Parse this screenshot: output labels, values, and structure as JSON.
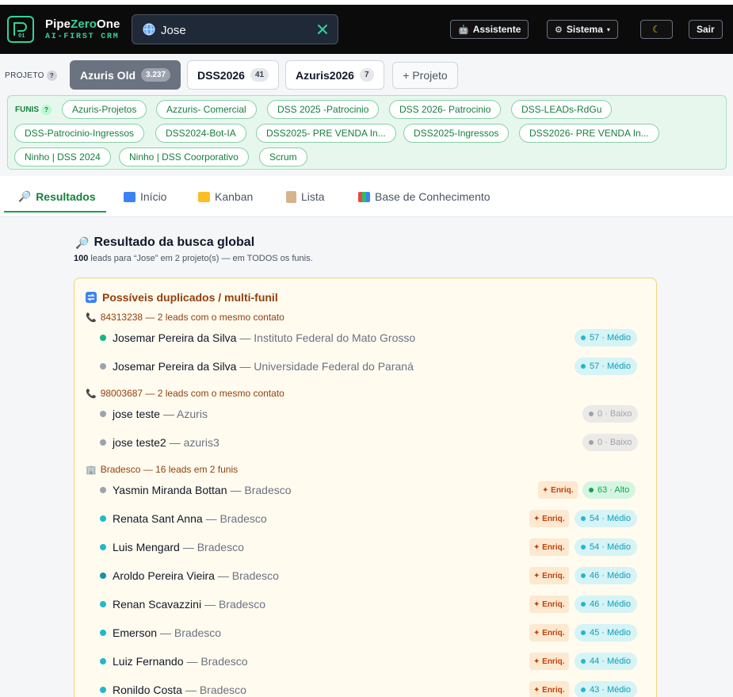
{
  "header": {
    "brand_part1": "Pipe",
    "brand_part2": "Zero",
    "brand_part3": "One",
    "brand_sub": "AI-FIRST CRM",
    "logo_text": "01",
    "search_value": "Jose",
    "buttons": {
      "assistente": "Assistente",
      "sistema": "Sistema",
      "sistema_caret": "▾",
      "theme_icon": "☾",
      "sair": "Sair"
    }
  },
  "projects": {
    "label": "PROJETO",
    "help": "?",
    "tabs": [
      {
        "label": "Azuris Old",
        "count": "3.237",
        "active": true
      },
      {
        "label": "DSS2026",
        "count": "41",
        "active": false
      },
      {
        "label": "Azuris2026",
        "count": "7",
        "active": false
      }
    ],
    "add_label": "+ Projeto"
  },
  "funis": {
    "label": "FUNIS",
    "help": "?",
    "chips": [
      "Azuris-Projetos",
      "Azzuris- Comercial",
      "DSS 2025 -Patrocinio",
      "DSS 2026- Patrocinio",
      "DSS-LEADs-RdGu",
      "DSS-Patrocinio-Ingressos",
      "DSS2024-Bot-IA",
      "DSS2025- PRE VENDA In...",
      "DSS2025-Ingressos",
      "DSS2026- PRE VENDA In...",
      "Ninho | DSS 2024",
      "Ninho | DSS Coorporativo",
      "Scrum"
    ]
  },
  "nav": {
    "tabs": [
      "Resultados",
      "Início",
      "Kanban",
      "Lista",
      "Base de Conhecimento"
    ],
    "active": "Resultados"
  },
  "results": {
    "title": "Resultado da busca global",
    "count": "100",
    "subtitle": "leads para “Jose” em 2 projeto(s) — em TODOS os funis."
  },
  "duplicates": {
    "title": "Possíveis duplicados / multi-funil",
    "groups": [
      {
        "header": "84313238 — 2 leads com o mesmo contato",
        "icon": "phone-icon",
        "rows": [
          {
            "name": "Josemar Pereira da Silva",
            "org": "— Instituto Federal do Mato Grosso",
            "dot": "#10b981",
            "score": "57 · Médio",
            "level": "medio",
            "enriq": false
          },
          {
            "name": "Josemar Pereira da Silva",
            "org": "— Universidade Federal do Paraná",
            "dot": "#9ca3af",
            "score": "57 · Médio",
            "level": "medio",
            "enriq": false
          }
        ]
      },
      {
        "header": "98003687 — 2 leads com o mesmo contato",
        "icon": "phone-icon",
        "rows": [
          {
            "name": "jose teste",
            "org": "— Azuris",
            "dot": "#9ca3af",
            "score": "0 · Baixo",
            "level": "baixo",
            "enriq": false
          },
          {
            "name": "jose teste2",
            "org": "— azuris3",
            "dot": "#9ca3af",
            "score": "0 · Baixo",
            "level": "baixo",
            "enriq": false
          }
        ]
      },
      {
        "header": "Bradesco — 16 leads em 2 funis",
        "icon": "building-icon",
        "rows": [
          {
            "name": "Yasmin Miranda Bottan",
            "org": "— Bradesco",
            "dot": "#9ca3af",
            "score": "63 · Alto",
            "level": "alto",
            "enriq": true
          },
          {
            "name": "Renata Sant Anna",
            "org": "— Bradesco",
            "dot": "#22b8cf",
            "score": "54 · Médio",
            "level": "medio",
            "enriq": true
          },
          {
            "name": "Luis Mengard",
            "org": "— Bradesco",
            "dot": "#22b8cf",
            "score": "54 · Médio",
            "level": "medio",
            "enriq": true
          },
          {
            "name": "Aroldo Pereira Vieira",
            "org": "— Bradesco",
            "dot": "#1591a8",
            "score": "46 · Médio",
            "level": "medio",
            "enriq": true
          },
          {
            "name": "Renan Scavazzini",
            "org": "— Bradesco",
            "dot": "#22b8cf",
            "score": "46 · Médio",
            "level": "medio",
            "enriq": true
          },
          {
            "name": "Emerson",
            "org": "— Bradesco",
            "dot": "#22b8cf",
            "score": "45 · Médio",
            "level": "medio",
            "enriq": true
          },
          {
            "name": "Luiz Fernando",
            "org": "— Bradesco",
            "dot": "#22b8cf",
            "score": "44 · Médio",
            "level": "medio",
            "enriq": true
          },
          {
            "name": "Ronildo Costa",
            "org": "— Bradesco",
            "dot": "#22b8cf",
            "score": "43 · Médio",
            "level": "medio",
            "enriq": true
          }
        ]
      }
    ],
    "enriq_label": "✦ Enriq."
  },
  "colors": {
    "accent": "#16a34a",
    "brand_green": "#34d399",
    "card_bg": "#fffbef",
    "card_border": "#f3d27a"
  }
}
